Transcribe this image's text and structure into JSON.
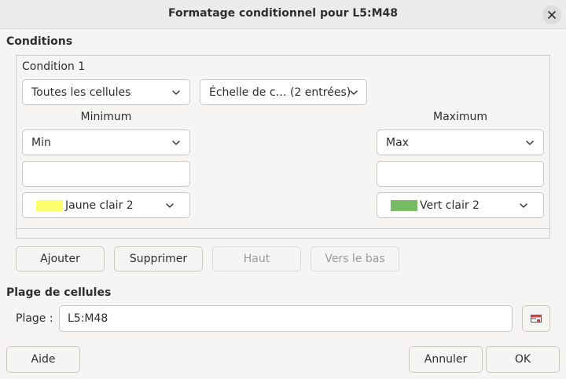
{
  "window": {
    "title": "Formatage conditionnel pour L5:M48"
  },
  "conditions": {
    "section_label": "Conditions",
    "condition_label": "Condition 1",
    "scope_select": "Toutes les cellules",
    "type_select": "Échelle de c…  (2 entrées)",
    "minimum": {
      "label": "Minimum",
      "type_select": "Min",
      "value": "",
      "color_label": "Jaune clair 2",
      "color": "#ffff6d"
    },
    "maximum": {
      "label": "Maximum",
      "type_select": "Max",
      "value": "",
      "color_label": "Vert clair 2",
      "color": "#77bc65"
    }
  },
  "actions": {
    "add": "Ajouter",
    "delete": "Supprimer",
    "up": "Haut",
    "down": "Vers le bas"
  },
  "range": {
    "section_label": "Plage de cellules",
    "label": "Plage :",
    "value": "L5:M48"
  },
  "footer": {
    "help": "Aide",
    "cancel": "Annuler",
    "ok": "OK"
  }
}
